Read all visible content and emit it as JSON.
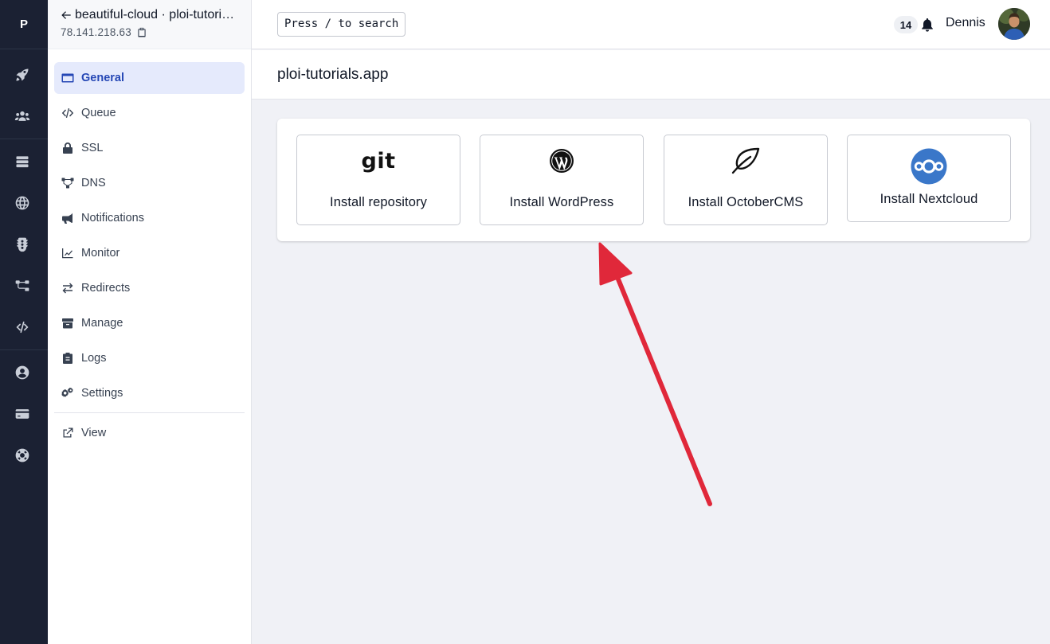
{
  "rail": {
    "logo": "P",
    "icons": [
      "rocket-icon",
      "users-icon",
      "servers-icon",
      "globe-icon",
      "traffic-light-icon",
      "network-icon",
      "code-icon",
      "user-circle-icon",
      "credit-card-icon",
      "lifebuoy-icon"
    ]
  },
  "site": {
    "name": "beautiful-cloud · ploi-tutorials.app",
    "ip": "78.141.218.63"
  },
  "nav": {
    "items": [
      {
        "label": "General",
        "icon": "window-icon",
        "active": true
      },
      {
        "label": "Queue",
        "icon": "code-icon"
      },
      {
        "label": "SSL",
        "icon": "lock-icon"
      },
      {
        "label": "DNS",
        "icon": "dns-icon"
      },
      {
        "label": "Notifications",
        "icon": "megaphone-icon"
      },
      {
        "label": "Monitor",
        "icon": "chart-line-icon"
      },
      {
        "label": "Redirects",
        "icon": "exchange-icon"
      },
      {
        "label": "Manage",
        "icon": "box-icon"
      },
      {
        "label": "Logs",
        "icon": "clipboard-icon"
      },
      {
        "label": "Settings",
        "icon": "cogs-icon"
      }
    ],
    "view_label": "View"
  },
  "topbar": {
    "search_label": "Press / to search",
    "notification_count": "14",
    "username": "Dennis"
  },
  "page": {
    "title": "ploi-tutorials.app"
  },
  "installers": {
    "git_logo_text": "git",
    "items": [
      {
        "label": "Install repository",
        "icon": "git-icon"
      },
      {
        "label": "Install WordPress",
        "icon": "wordpress-icon"
      },
      {
        "label": "Install OctoberCMS",
        "icon": "leaf-icon"
      },
      {
        "label": "Install Nextcloud",
        "icon": "nextcloud-icon"
      }
    ]
  },
  "colors": {
    "rail_bg": "#1b2133",
    "active_nav_bg": "#e5eafc",
    "active_nav_text": "#2547b5",
    "annotation_arrow": "#e0283a",
    "nextcloud_blue": "#3a77c9"
  }
}
